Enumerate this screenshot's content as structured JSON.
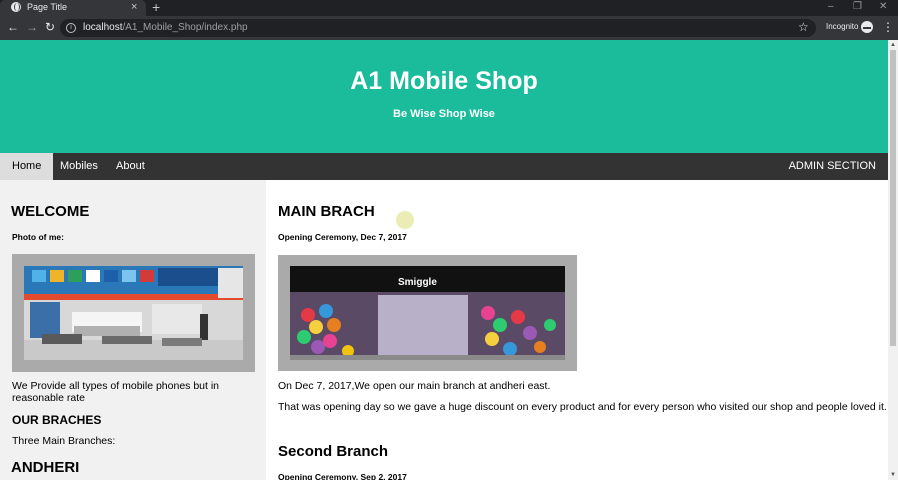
{
  "browser": {
    "tab_title": "Page Title",
    "new_tab_label": "+",
    "url_host": "localhost",
    "url_path": "/A1_Mobile_Shop/index.php",
    "incognito_label": "Incognito",
    "icons": {
      "back": "←",
      "forward": "→",
      "reload": "↻",
      "close_tab": "×",
      "star": "☆",
      "menu": "⋮",
      "minimize": "–",
      "restore": "❐",
      "close_window": "✕"
    }
  },
  "header": {
    "title": "A1 Mobile Shop",
    "tagline": "Be Wise Shop Wise"
  },
  "nav": {
    "home": "Home",
    "mobiles": "Mobiles",
    "about": "About",
    "admin": "ADMIN SECTION"
  },
  "sidebar": {
    "welcome_heading": "WELCOME",
    "photo_label": "Photo of me:",
    "description": "We Provide all types of mobile phones but in reasonable rate",
    "branches_heading": "OUR BRACHES",
    "branches_text": "Three Main Branches:",
    "branch_name": "ANDHERI"
  },
  "main": {
    "post1": {
      "heading": "MAIN BRACH",
      "subheading": "Opening Ceremony, Dec 7, 2017",
      "para1": "On Dec 7, 2017,We open our main branch at andheri east.",
      "para2": "That was opening day so we gave a huge discount on every product and for every person who visited our shop and people loved it."
    },
    "post2": {
      "heading": "Second Branch",
      "subheading": "Opening Ceremony, Sep 2, 2017"
    },
    "store_sign": "Smiggle"
  },
  "colors": {
    "header_bg": "#1abc9c",
    "nav_bg": "#333333",
    "sidebar_bg": "#f1f1f1"
  }
}
